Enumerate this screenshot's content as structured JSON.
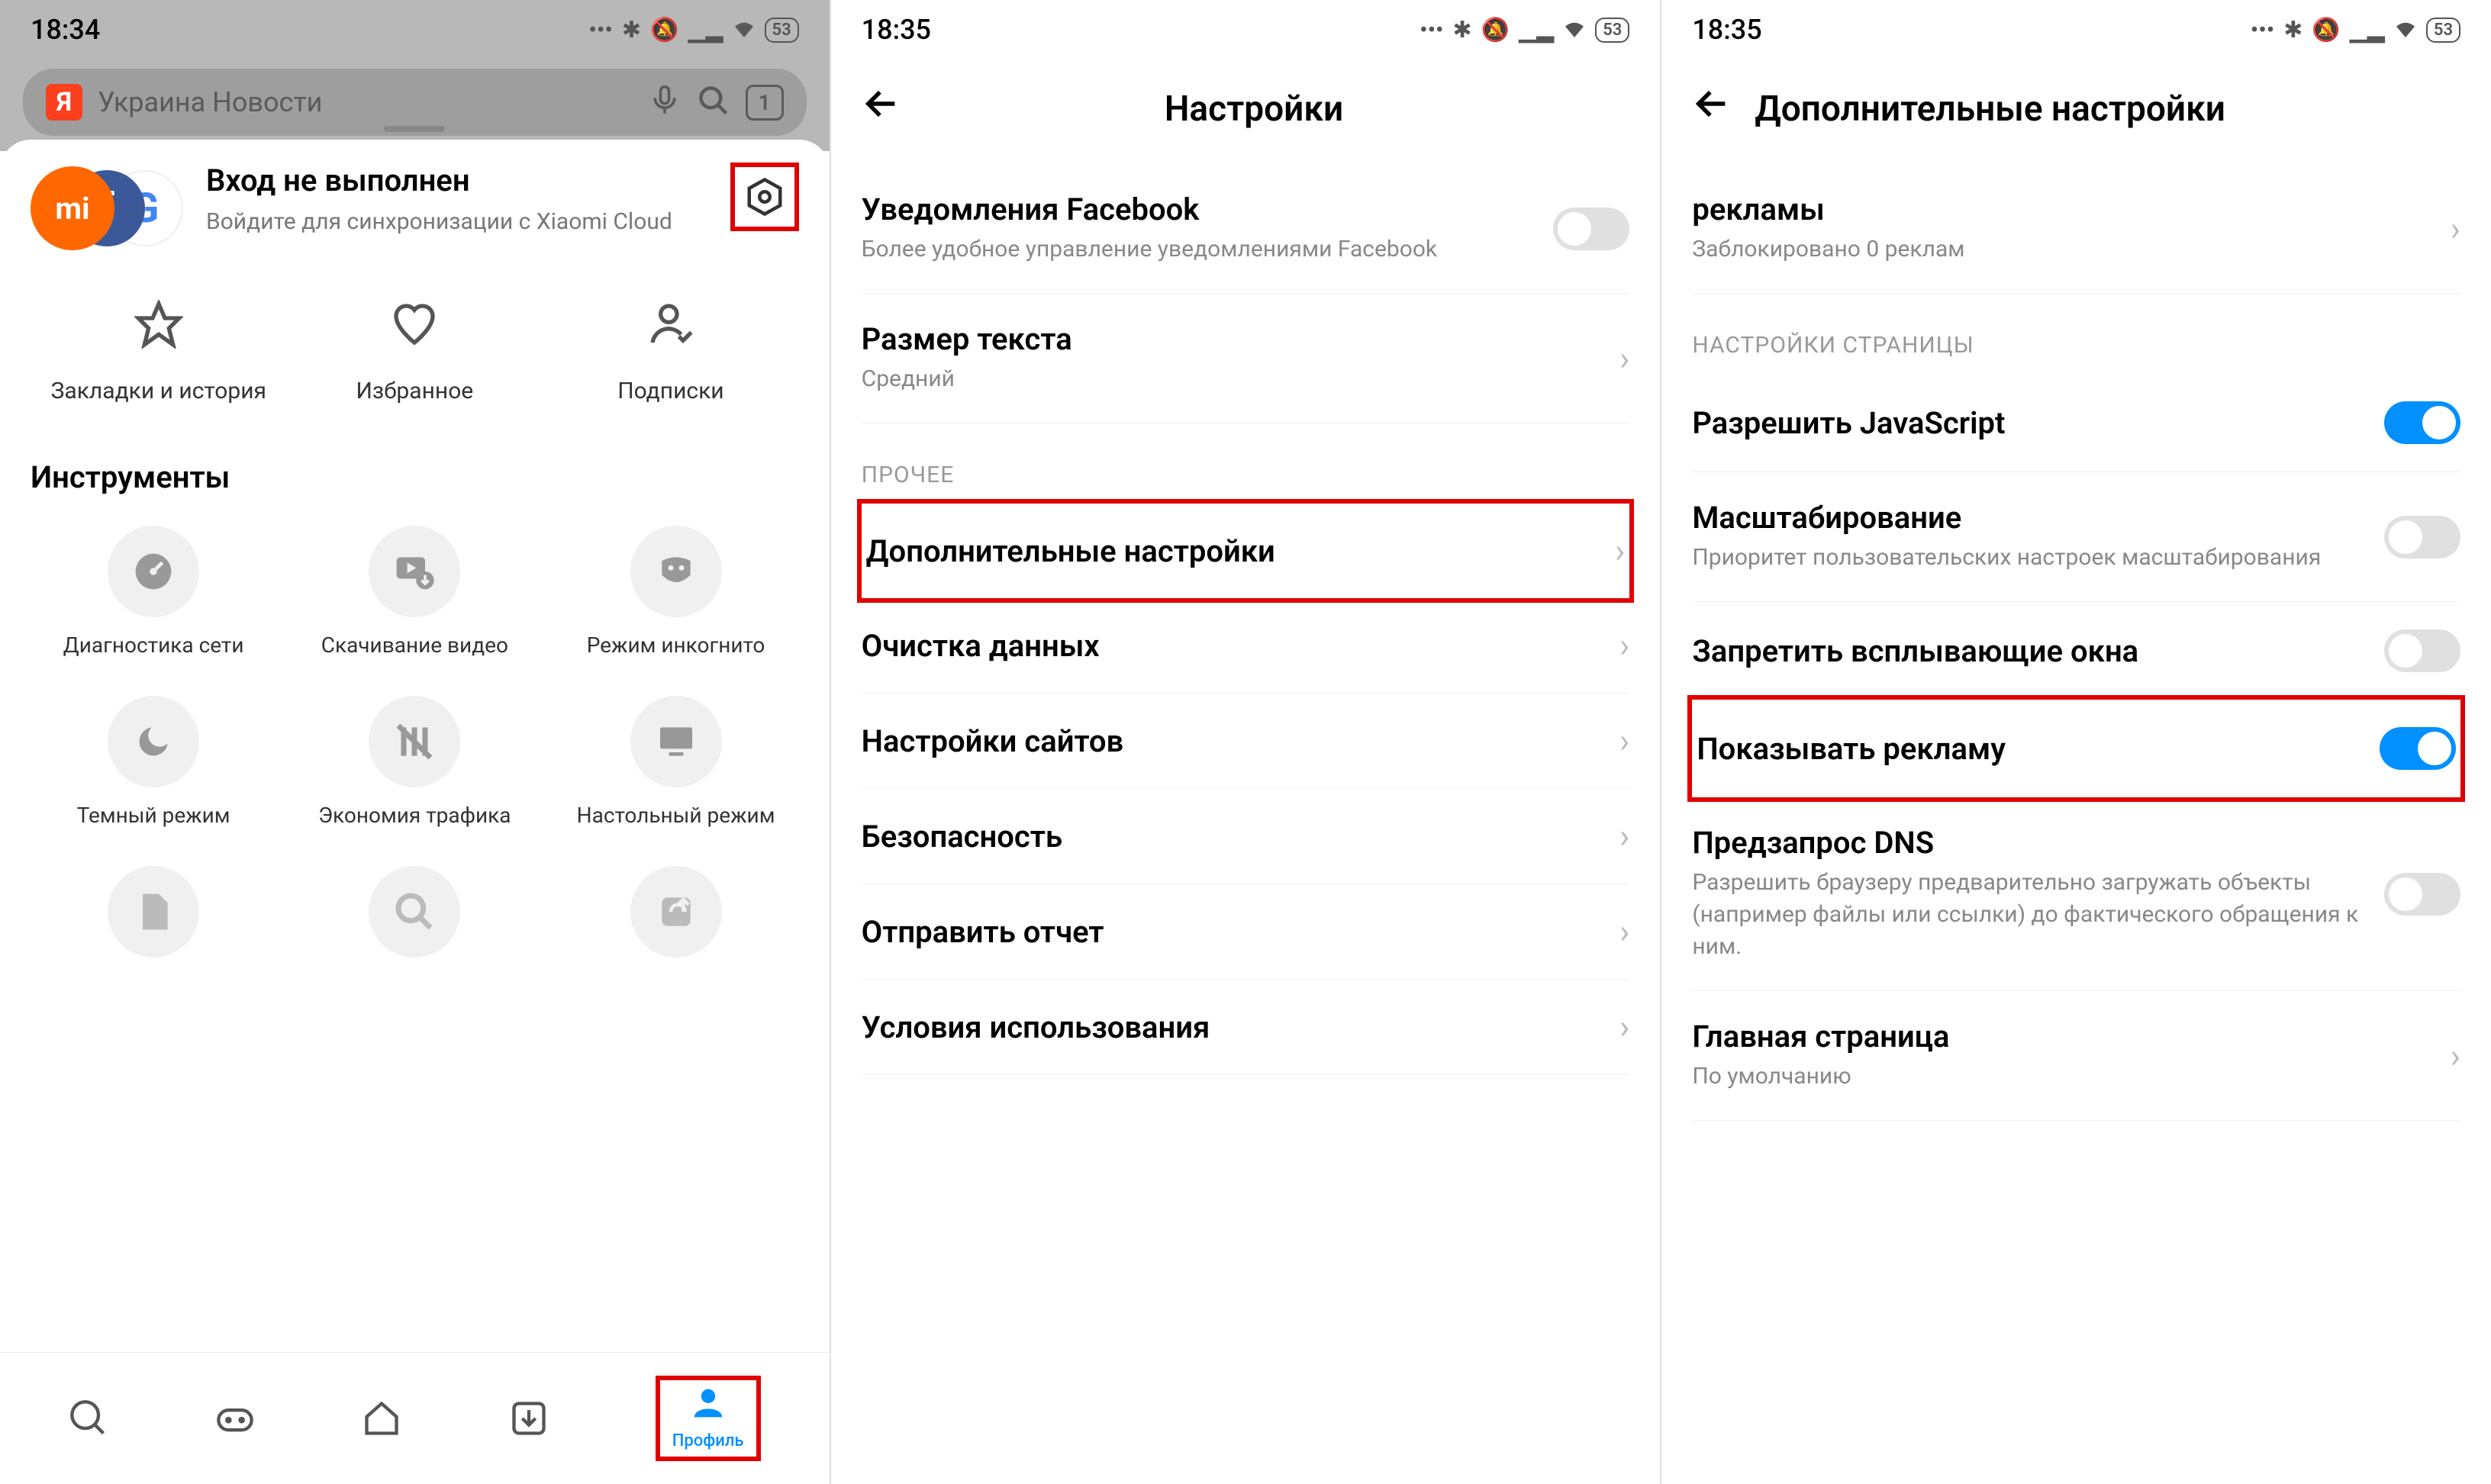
{
  "screen1": {
    "status_time": "18:34",
    "battery": "53",
    "search_placeholder": "Украина Новости",
    "tab_count": "1",
    "profile_title": "Вход не выполнен",
    "profile_sub": "Войдите для синхронизации с Xiaomi Cloud",
    "quick": [
      {
        "label": "Закладки и история"
      },
      {
        "label": "Избранное"
      },
      {
        "label": "Подписки"
      }
    ],
    "tools_header": "Инструменты",
    "tools": [
      {
        "label": "Диагностика сети"
      },
      {
        "label": "Скачивание видео"
      },
      {
        "label": "Режим инкогнито"
      },
      {
        "label": "Темный режим"
      },
      {
        "label": "Экономия трафика"
      },
      {
        "label": "Настольный режим"
      }
    ],
    "profile_tab_label": "Профиль"
  },
  "screen2": {
    "status_time": "18:35",
    "battery": "53",
    "header_title": "Настройки",
    "fb_title": "Уведомления Facebook",
    "fb_sub": "Более удобное управление уведомлениями Facebook",
    "textsize_title": "Размер текста",
    "textsize_value": "Средний",
    "section_other": "ПРОЧЕЕ",
    "items": [
      {
        "label": "Дополнительные настройки",
        "highlight": true
      },
      {
        "label": "Очистка данных"
      },
      {
        "label": "Настройки сайтов"
      },
      {
        "label": "Безопасность"
      },
      {
        "label": "Отправить отчет"
      },
      {
        "label": "Условия использования"
      }
    ]
  },
  "screen3": {
    "status_time": "18:35",
    "battery": "53",
    "header_title": "Дополнительные настройки",
    "partial_title": "рекламы",
    "partial_sub": "Заблокировано 0 реклам",
    "section_page": "НАСТРОЙКИ СТРАНИЦЫ",
    "js_title": "Разрешить JavaScript",
    "zoom_title": "Масштабирование",
    "zoom_sub": "Приоритет пользовательских настроек масштабирования",
    "popup_title": "Запретить всплывающие окна",
    "ads_title": "Показывать рекламу",
    "dns_title": "Предзапрос DNS",
    "dns_sub": "Разрешить браузеру предварительно загружать объекты (например файлы или ссылки) до фактического обращения к ним.",
    "home_title": "Главная страница",
    "home_sub": "По умолчанию"
  }
}
